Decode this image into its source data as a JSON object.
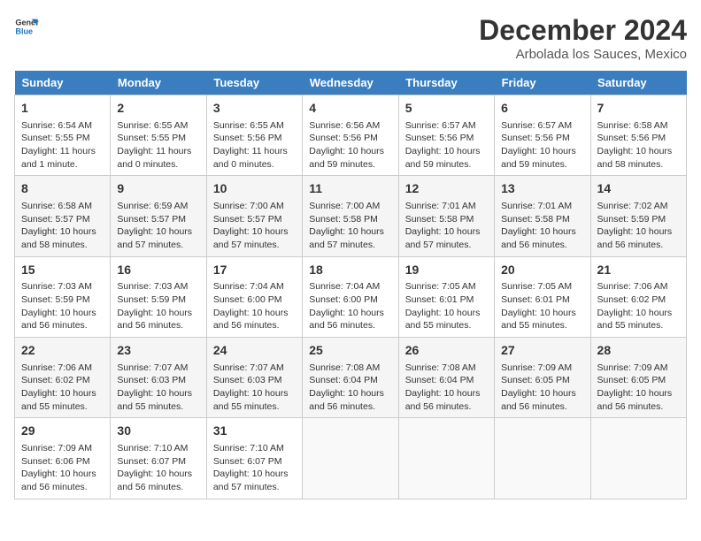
{
  "logo": {
    "line1": "General",
    "line2": "Blue"
  },
  "title": "December 2024",
  "location": "Arbolada los Sauces, Mexico",
  "days_of_week": [
    "Sunday",
    "Monday",
    "Tuesday",
    "Wednesday",
    "Thursday",
    "Friday",
    "Saturday"
  ],
  "weeks": [
    [
      {
        "day": "1",
        "info": "Sunrise: 6:54 AM\nSunset: 5:55 PM\nDaylight: 11 hours\nand 1 minute."
      },
      {
        "day": "2",
        "info": "Sunrise: 6:55 AM\nSunset: 5:55 PM\nDaylight: 11 hours\nand 0 minutes."
      },
      {
        "day": "3",
        "info": "Sunrise: 6:55 AM\nSunset: 5:56 PM\nDaylight: 11 hours\nand 0 minutes."
      },
      {
        "day": "4",
        "info": "Sunrise: 6:56 AM\nSunset: 5:56 PM\nDaylight: 10 hours\nand 59 minutes."
      },
      {
        "day": "5",
        "info": "Sunrise: 6:57 AM\nSunset: 5:56 PM\nDaylight: 10 hours\nand 59 minutes."
      },
      {
        "day": "6",
        "info": "Sunrise: 6:57 AM\nSunset: 5:56 PM\nDaylight: 10 hours\nand 59 minutes."
      },
      {
        "day": "7",
        "info": "Sunrise: 6:58 AM\nSunset: 5:56 PM\nDaylight: 10 hours\nand 58 minutes."
      }
    ],
    [
      {
        "day": "8",
        "info": "Sunrise: 6:58 AM\nSunset: 5:57 PM\nDaylight: 10 hours\nand 58 minutes."
      },
      {
        "day": "9",
        "info": "Sunrise: 6:59 AM\nSunset: 5:57 PM\nDaylight: 10 hours\nand 57 minutes."
      },
      {
        "day": "10",
        "info": "Sunrise: 7:00 AM\nSunset: 5:57 PM\nDaylight: 10 hours\nand 57 minutes."
      },
      {
        "day": "11",
        "info": "Sunrise: 7:00 AM\nSunset: 5:58 PM\nDaylight: 10 hours\nand 57 minutes."
      },
      {
        "day": "12",
        "info": "Sunrise: 7:01 AM\nSunset: 5:58 PM\nDaylight: 10 hours\nand 57 minutes."
      },
      {
        "day": "13",
        "info": "Sunrise: 7:01 AM\nSunset: 5:58 PM\nDaylight: 10 hours\nand 56 minutes."
      },
      {
        "day": "14",
        "info": "Sunrise: 7:02 AM\nSunset: 5:59 PM\nDaylight: 10 hours\nand 56 minutes."
      }
    ],
    [
      {
        "day": "15",
        "info": "Sunrise: 7:03 AM\nSunset: 5:59 PM\nDaylight: 10 hours\nand 56 minutes."
      },
      {
        "day": "16",
        "info": "Sunrise: 7:03 AM\nSunset: 5:59 PM\nDaylight: 10 hours\nand 56 minutes."
      },
      {
        "day": "17",
        "info": "Sunrise: 7:04 AM\nSunset: 6:00 PM\nDaylight: 10 hours\nand 56 minutes."
      },
      {
        "day": "18",
        "info": "Sunrise: 7:04 AM\nSunset: 6:00 PM\nDaylight: 10 hours\nand 56 minutes."
      },
      {
        "day": "19",
        "info": "Sunrise: 7:05 AM\nSunset: 6:01 PM\nDaylight: 10 hours\nand 55 minutes."
      },
      {
        "day": "20",
        "info": "Sunrise: 7:05 AM\nSunset: 6:01 PM\nDaylight: 10 hours\nand 55 minutes."
      },
      {
        "day": "21",
        "info": "Sunrise: 7:06 AM\nSunset: 6:02 PM\nDaylight: 10 hours\nand 55 minutes."
      }
    ],
    [
      {
        "day": "22",
        "info": "Sunrise: 7:06 AM\nSunset: 6:02 PM\nDaylight: 10 hours\nand 55 minutes."
      },
      {
        "day": "23",
        "info": "Sunrise: 7:07 AM\nSunset: 6:03 PM\nDaylight: 10 hours\nand 55 minutes."
      },
      {
        "day": "24",
        "info": "Sunrise: 7:07 AM\nSunset: 6:03 PM\nDaylight: 10 hours\nand 55 minutes."
      },
      {
        "day": "25",
        "info": "Sunrise: 7:08 AM\nSunset: 6:04 PM\nDaylight: 10 hours\nand 56 minutes."
      },
      {
        "day": "26",
        "info": "Sunrise: 7:08 AM\nSunset: 6:04 PM\nDaylight: 10 hours\nand 56 minutes."
      },
      {
        "day": "27",
        "info": "Sunrise: 7:09 AM\nSunset: 6:05 PM\nDaylight: 10 hours\nand 56 minutes."
      },
      {
        "day": "28",
        "info": "Sunrise: 7:09 AM\nSunset: 6:05 PM\nDaylight: 10 hours\nand 56 minutes."
      }
    ],
    [
      {
        "day": "29",
        "info": "Sunrise: 7:09 AM\nSunset: 6:06 PM\nDaylight: 10 hours\nand 56 minutes."
      },
      {
        "day": "30",
        "info": "Sunrise: 7:10 AM\nSunset: 6:07 PM\nDaylight: 10 hours\nand 56 minutes."
      },
      {
        "day": "31",
        "info": "Sunrise: 7:10 AM\nSunset: 6:07 PM\nDaylight: 10 hours\nand 57 minutes."
      },
      {
        "day": "",
        "info": ""
      },
      {
        "day": "",
        "info": ""
      },
      {
        "day": "",
        "info": ""
      },
      {
        "day": "",
        "info": ""
      }
    ]
  ]
}
